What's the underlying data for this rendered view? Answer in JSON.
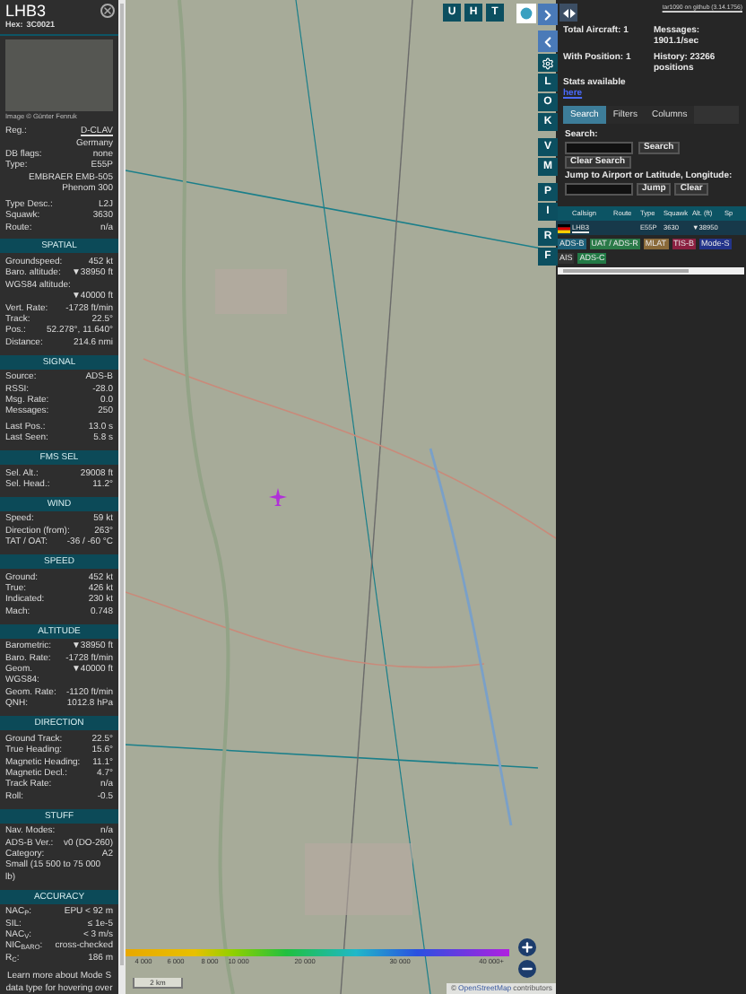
{
  "aircraft": {
    "callsign": "LHB3",
    "hex_label": "Hex:",
    "hex": "3C0021",
    "photo_credit": "Image © Günter Fenruk"
  },
  "sections": [
    {
      "groups": [
        [
          {
            "kind": "link",
            "label": "Reg.:",
            "value": "D-CLAV"
          },
          {
            "kind": "value",
            "value": "Germany"
          },
          {
            "kind": "pair",
            "label": "DB flags:",
            "value": "none"
          },
          {
            "kind": "pair",
            "label": "Type:",
            "value": "E55P"
          },
          {
            "kind": "value",
            "value": "EMBRAER EMB-505 Phenom 300"
          }
        ],
        [
          {
            "kind": "pair",
            "label": "Type Desc.:",
            "value": "L2J"
          },
          {
            "kind": "pair",
            "label": "Squawk:",
            "value": "3630"
          },
          {
            "kind": "pair",
            "label": "Route:",
            "value": "n/a"
          }
        ]
      ]
    },
    {
      "title": "SPATIAL",
      "groups": [
        [
          {
            "kind": "pair",
            "label": "Groundspeed:",
            "value": "452 kt"
          },
          {
            "kind": "pair",
            "label": "Baro. altitude:",
            "value": "▼38950 ft"
          },
          {
            "kind": "stacked",
            "label": "WGS84 altitude:",
            "value": "▼40000 ft"
          },
          {
            "kind": "pair",
            "label": "Vert. Rate:",
            "value": "-1728 ft/min"
          },
          {
            "kind": "pair",
            "label": "Track:",
            "value": "22.5°"
          },
          {
            "kind": "pair",
            "label": "Pos.:",
            "value": "52.278°, 11.640°"
          },
          {
            "kind": "pair",
            "label": "Distance:",
            "value": "214.6 nmi"
          }
        ]
      ]
    },
    {
      "title": "SIGNAL",
      "groups": [
        [
          {
            "kind": "pair",
            "label": "Source:",
            "value": "ADS-B"
          },
          {
            "kind": "pair",
            "label": "RSSI:",
            "value": "-28.0"
          },
          {
            "kind": "pair",
            "label": "Msg. Rate:",
            "value": "0.0"
          },
          {
            "kind": "pair",
            "label": "Messages:",
            "value": "250"
          }
        ],
        [
          {
            "kind": "pair",
            "label": "Last Pos.:",
            "value": "13.0 s"
          },
          {
            "kind": "pair",
            "label": "Last Seen:",
            "value": "5.8 s"
          }
        ]
      ]
    },
    {
      "title": "FMS SEL",
      "groups": [
        [
          {
            "kind": "pair",
            "label": "Sel. Alt.:",
            "value": "29008 ft"
          },
          {
            "kind": "pair",
            "label": "Sel. Head.:",
            "value": "11.2°"
          }
        ]
      ]
    },
    {
      "title": "WIND",
      "groups": [
        [
          {
            "kind": "pair",
            "label": "Speed:",
            "value": "59 kt"
          },
          {
            "kind": "pair",
            "label": "Direction (from):",
            "value": "263°"
          },
          {
            "kind": "pair",
            "label": "TAT / OAT:",
            "value": "-36 / -60 °C"
          }
        ]
      ]
    },
    {
      "title": "SPEED",
      "groups": [
        [
          {
            "kind": "pair",
            "label": "Ground:",
            "value": "452 kt"
          },
          {
            "kind": "pair",
            "label": "True:",
            "value": "426 kt"
          },
          {
            "kind": "pair",
            "label": "Indicated:",
            "value": "230 kt"
          },
          {
            "kind": "pair",
            "label": "Mach:",
            "value": "0.748"
          }
        ]
      ]
    },
    {
      "title": "ALTITUDE",
      "groups": [
        [
          {
            "kind": "pair",
            "label": "Barometric:",
            "value": "▼38950 ft"
          },
          {
            "kind": "pair",
            "label": "Baro. Rate:",
            "value": "-1728 ft/min"
          },
          {
            "kind": "pair",
            "label": "Geom. WGS84:",
            "value": "▼40000 ft"
          },
          {
            "kind": "pair",
            "label": "Geom. Rate:",
            "value": "-1120 ft/min"
          },
          {
            "kind": "pair",
            "label": "QNH:",
            "value": "1012.8 hPa"
          }
        ]
      ]
    },
    {
      "title": "DIRECTION",
      "groups": [
        [
          {
            "kind": "pair",
            "label": "Ground Track:",
            "value": "22.5°"
          },
          {
            "kind": "pair",
            "label": "True Heading:",
            "value": "15.6°"
          },
          {
            "kind": "pair",
            "label": "Magnetic Heading:",
            "value": "11.1°"
          },
          {
            "kind": "pair",
            "label": "Magnetic Decl.:",
            "value": "4.7°"
          },
          {
            "kind": "pair",
            "label": "Track Rate:",
            "value": "n/a"
          },
          {
            "kind": "pair",
            "label": "Roll:",
            "value": "-0.5"
          }
        ]
      ]
    },
    {
      "title": "STUFF",
      "groups": [
        [
          {
            "kind": "pair",
            "label": "Nav. Modes:",
            "value": "n/a"
          },
          {
            "kind": "pair",
            "label": "ADS-B Ver.:",
            "value": "v0 (DO-260)"
          },
          {
            "kind": "pair",
            "label": "Category:",
            "value": "A2"
          },
          {
            "kind": "text",
            "value": "Small (15 500 to 75 000 lb)"
          }
        ]
      ]
    },
    {
      "title": "ACCURACY",
      "groups": [
        [
          {
            "kind": "pair",
            "label": "NAC$_{P}$:",
            "value": "EPU < 92 m"
          },
          {
            "kind": "pair",
            "label": "SIL:",
            "value": "≤ 1e-5"
          },
          {
            "kind": "pair",
            "label": "NAC$_{V}$:",
            "value": "< 3 m/s"
          },
          {
            "kind": "pair",
            "label": "NIC$_{BARO}$:",
            "value": "cross-checked"
          },
          {
            "kind": "pair",
            "label": "R$_{C}$:",
            "value": "186 m"
          }
        ]
      ]
    }
  ],
  "footer_note": "Learn more about Mode S data type for hovering over",
  "map": {
    "top_buttons": [
      "U",
      "H",
      "T"
    ],
    "side_groups": [
      [
        "L",
        "O",
        "K"
      ],
      [
        "V",
        "M"
      ],
      [
        "P",
        "I"
      ],
      [
        "R",
        "F"
      ]
    ],
    "altitude_legend": [
      "4 000",
      "6 000",
      "8 000",
      "10 000",
      "20 000",
      "30 000",
      "40 000+"
    ],
    "scale": "2 km",
    "attribution_prefix": "©",
    "attribution_link": "OpenStreetMap",
    "attribution_suffix": "contributors"
  },
  "right": {
    "version_link": "tar1090 on github (3.14.1756)",
    "stats": [
      "Total Aircraft: 1",
      "Messages: 1901.1/sec",
      "With Position: 1",
      "History: 23266 positions"
    ],
    "stats_note": "Stats available",
    "stats_link": "here",
    "tabs": [
      {
        "label": "Search",
        "selected": true
      },
      {
        "label": "Filters",
        "selected": false
      },
      {
        "label": "Columns",
        "selected": false
      }
    ],
    "search": {
      "label": "Search:",
      "button": "Search",
      "clear": "Clear Search",
      "jump_label": "Jump to Airport or Latitude, Longitude:",
      "jump_button": "Jump",
      "jump_clear": "Clear"
    },
    "table": {
      "columns": [
        "Callsign",
        "Route",
        "Type",
        "Squawk",
        "Alt. (ft)",
        "Sp"
      ],
      "rows": [
        {
          "callsign": "LHB3",
          "type": "E55P",
          "squawk": "3630",
          "altitude": "▼38950",
          "selected": true
        }
      ]
    },
    "badges": [
      {
        "label": "ADS-B",
        "color": "#1c5f78"
      },
      {
        "label": "UAT / ADS-R",
        "color": "#2a7a48"
      },
      {
        "label": "MLAT",
        "color": "#8a6a3a"
      },
      {
        "label": "TIS-B",
        "color": "#8a2040"
      },
      {
        "label": "Mode-S",
        "color": "#23348a"
      },
      {
        "label": "AIS",
        "color": "#333333"
      },
      {
        "label": "ADS-C",
        "color": "#237a46"
      }
    ]
  }
}
